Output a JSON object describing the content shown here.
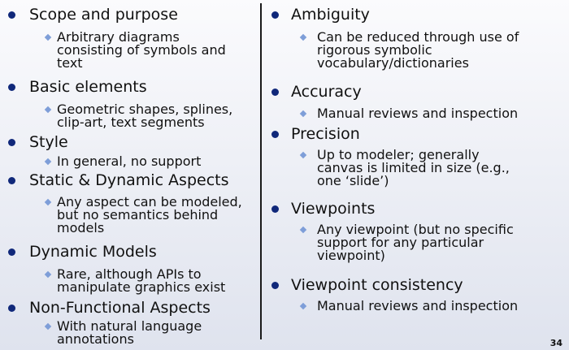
{
  "left": [
    {
      "heading": "Scope and purpose",
      "sub": [
        "Arbitrary diagrams",
        "consisting of symbols and",
        "text"
      ]
    },
    {
      "heading": "Basic elements",
      "sub": [
        "Geometric shapes, splines,",
        "clip-art, text segments"
      ]
    },
    {
      "heading": "Style",
      "sub": [
        "In general, no support"
      ]
    },
    {
      "heading": "Static & Dynamic Aspects",
      "sub": [
        "Any aspect can be modeled,",
        "but no semantics behind",
        "models"
      ]
    },
    {
      "heading": "Dynamic Models",
      "sub": [
        "Rare, although APIs to",
        "manipulate graphics exist"
      ]
    },
    {
      "heading": "Non-Functional Aspects",
      "sub": [
        "With natural language",
        "annotations"
      ]
    }
  ],
  "right": [
    {
      "heading": "Ambiguity",
      "sub": [
        "Can be reduced through use of",
        "rigorous symbolic",
        "vocabulary/dictionaries"
      ]
    },
    {
      "heading": "Accuracy",
      "sub": [
        "Manual reviews and inspection"
      ]
    },
    {
      "heading": "Precision",
      "sub": [
        "Up to modeler; generally",
        "canvas is limited in size (e.g.,",
        "one ‘slide’)"
      ]
    },
    {
      "heading": "Viewpoints",
      "sub": [
        "Any viewpoint (but no specific",
        "support for any particular",
        "viewpoint)"
      ]
    },
    {
      "heading": "Viewpoint consistency",
      "sub": [
        "Manual reviews and inspection"
      ]
    }
  ],
  "page_number": "34"
}
